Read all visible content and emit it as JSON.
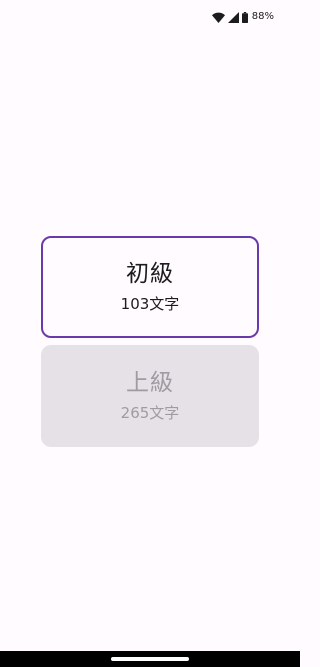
{
  "status_bar": {
    "battery_percent": "88%",
    "icons": [
      "wifi-icon",
      "cellular-signal-icon",
      "battery-icon"
    ]
  },
  "levels": [
    {
      "title": "初級",
      "count": "103文字",
      "state": "selected"
    },
    {
      "title": "上級",
      "count": "265文字",
      "state": "disabled"
    }
  ],
  "colors": {
    "background": "#fffbfe",
    "selected_border": "#6a3aaa",
    "disabled_fill": "#e5e1e7",
    "disabled_text": "#9e9ba2",
    "primary_text": "#1c1b1f",
    "navigation_bar": "#000000"
  }
}
